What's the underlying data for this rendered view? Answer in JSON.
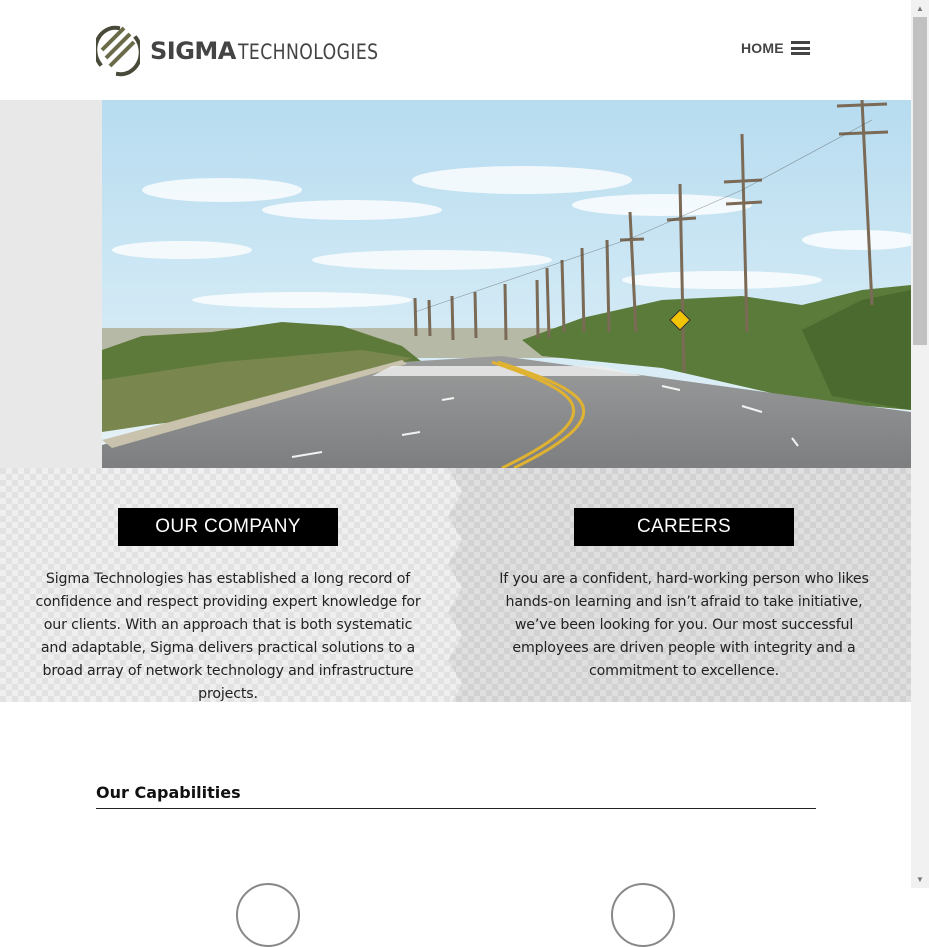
{
  "header": {
    "logo_strong": "SIGMA",
    "logo_light": "TECHNOLOGIES",
    "nav_label": "HOME"
  },
  "promo": {
    "company": {
      "button_label": "OUR COMPANY",
      "text": "Sigma Technologies has established a long record of confidence and respect providing expert knowledge for our clients. With an approach that is both systematic and adaptable, Sigma delivers practical solutions to a broad array of network technology and infrastructure projects."
    },
    "careers": {
      "button_label": "CAREERS",
      "text": "If you are a confident, hard-working person who likes hands-on learning and isn’t afraid to take initiative, we’ve been looking for you. Our most successful employees are driven people with integrity and a commitment to excellence."
    }
  },
  "capabilities": {
    "title": "Our Capabilities"
  },
  "icons": [
    "sigma-logo-icon",
    "hamburger-menu-icon",
    "scroll-up-arrow-icon",
    "scroll-down-arrow-icon"
  ],
  "colors": {
    "text_dark": "#444444",
    "button_bg": "#000000",
    "button_text": "#ffffff"
  }
}
